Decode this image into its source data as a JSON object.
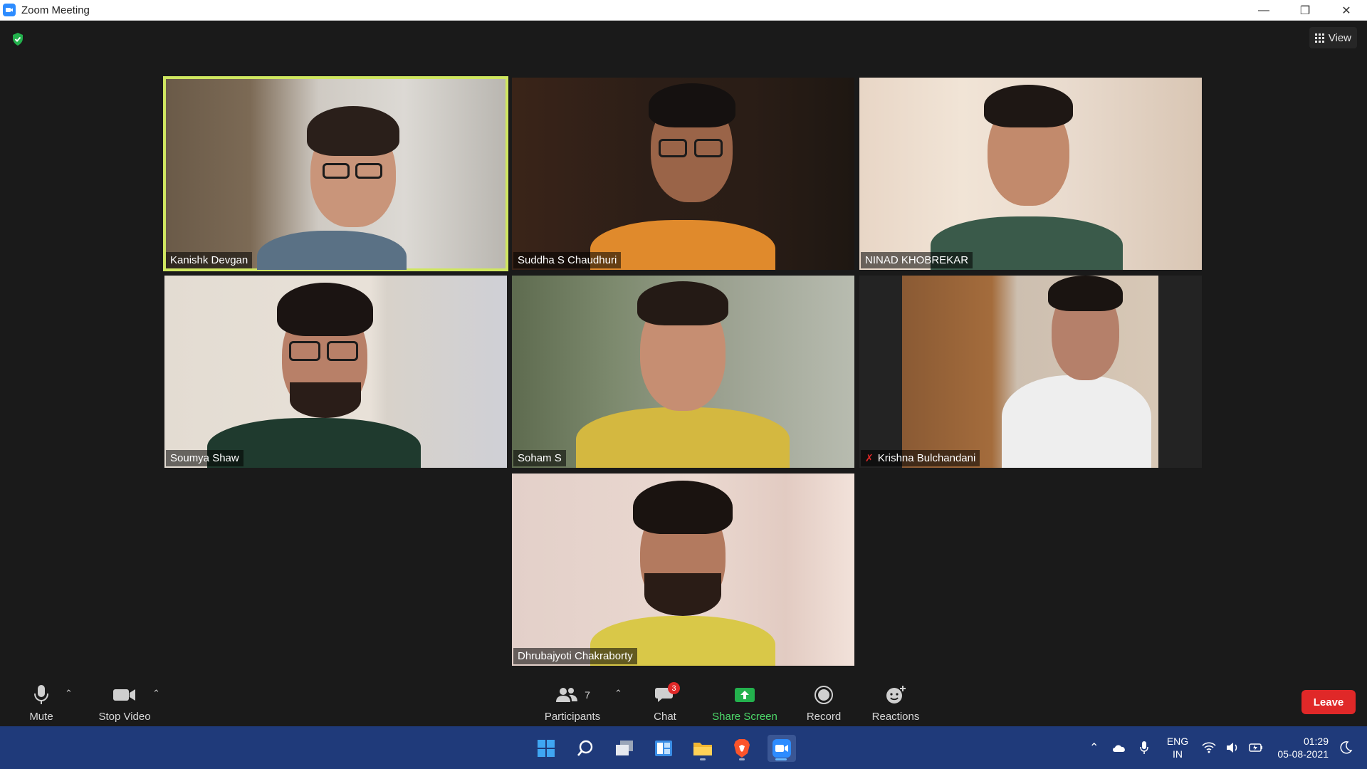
{
  "window": {
    "title": "Zoom Meeting"
  },
  "header": {
    "view_label": "View"
  },
  "participants": [
    {
      "name": "Kanishk Devgan",
      "active_speaker": true,
      "muted": false
    },
    {
      "name": "Suddha S Chaudhuri",
      "active_speaker": false,
      "muted": false
    },
    {
      "name": "NINAD KHOBREKAR",
      "active_speaker": false,
      "muted": false
    },
    {
      "name": "Soumya Shaw",
      "active_speaker": false,
      "muted": false
    },
    {
      "name": "Soham S",
      "active_speaker": false,
      "muted": false
    },
    {
      "name": "Krishna Bulchandani",
      "active_speaker": false,
      "muted": true
    },
    {
      "name": "Dhrubajyoti Chakraborty",
      "active_speaker": false,
      "muted": false
    }
  ],
  "toolbar": {
    "mute_label": "Mute",
    "stop_video_label": "Stop Video",
    "participants_label": "Participants",
    "participants_count": "7",
    "chat_label": "Chat",
    "chat_badge": "3",
    "share_screen_label": "Share Screen",
    "record_label": "Record",
    "reactions_label": "Reactions",
    "leave_label": "Leave"
  },
  "taskbar": {
    "language_top": "ENG",
    "language_bottom": "IN",
    "time": "01:29",
    "date": "05-08-2021",
    "apps": [
      "start-icon",
      "search-icon",
      "task-view-icon",
      "widgets-icon",
      "file-explorer-icon",
      "brave-browser-icon",
      "zoom-icon"
    ]
  },
  "colors": {
    "active_speaker_border": "#cfe660",
    "leave_button": "#e02828",
    "share_screen": "#4dd96a",
    "taskbar": "#1f3a7a"
  }
}
